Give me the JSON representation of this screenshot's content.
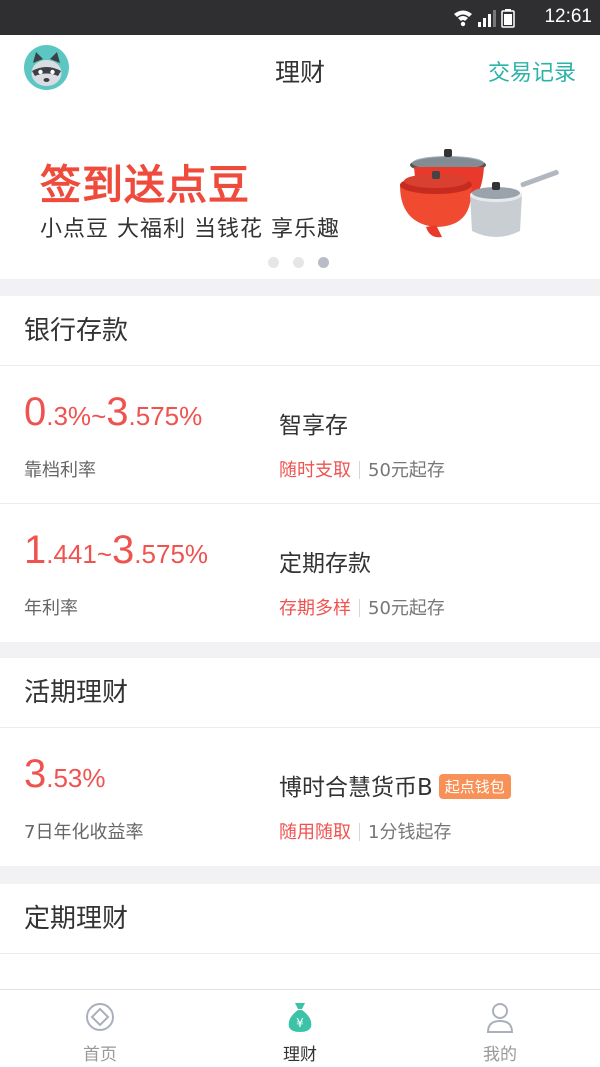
{
  "status_bar": {
    "time": "12:61"
  },
  "header": {
    "title": "理财",
    "records_link": "交易记录",
    "avatar": "raccoon-avatar"
  },
  "banner": {
    "headline": "签到送点豆",
    "subtitle": "小点豆 大福利 当钱花 享乐趣",
    "slide_count": 3,
    "active_slide": 3
  },
  "sections": {
    "bank": {
      "title": "银行存款",
      "products": [
        {
          "rate_a_int": "0",
          "rate_a_dec": ".3%",
          "sep": "~",
          "rate_b_int": "3",
          "rate_b_dec": ".575%",
          "rate_label": "靠档利率",
          "name": "智享存",
          "highlight": "随时支取",
          "note": "50元起存"
        },
        {
          "rate_a_int": "1",
          "rate_a_dec": ".441",
          "sep": "~",
          "rate_b_int": "3",
          "rate_b_dec": ".575%",
          "rate_label": "年利率",
          "name": "定期存款",
          "highlight": "存期多样",
          "note": "50元起存"
        }
      ]
    },
    "current": {
      "title": "活期理财",
      "products": [
        {
          "rate_int": "3",
          "rate_dec": ".53%",
          "rate_label": "7日年化收益率",
          "name": "博时合慧货币B",
          "badge": "起点钱包",
          "highlight": "随用随取",
          "note": "1分钱起存"
        }
      ]
    },
    "fixed": {
      "title": "定期理财"
    }
  },
  "tabbar": {
    "items": [
      {
        "label": "首页",
        "icon": "home-coin-icon",
        "active": false
      },
      {
        "label": "理财",
        "icon": "money-bag-icon",
        "active": true
      },
      {
        "label": "我的",
        "icon": "person-icon",
        "active": false
      }
    ]
  },
  "colors": {
    "accent_teal": "#2bb3a8",
    "rate_red": "#ef5350",
    "badge_orange": "#f79158",
    "headline_red": "#ef4b3c"
  }
}
